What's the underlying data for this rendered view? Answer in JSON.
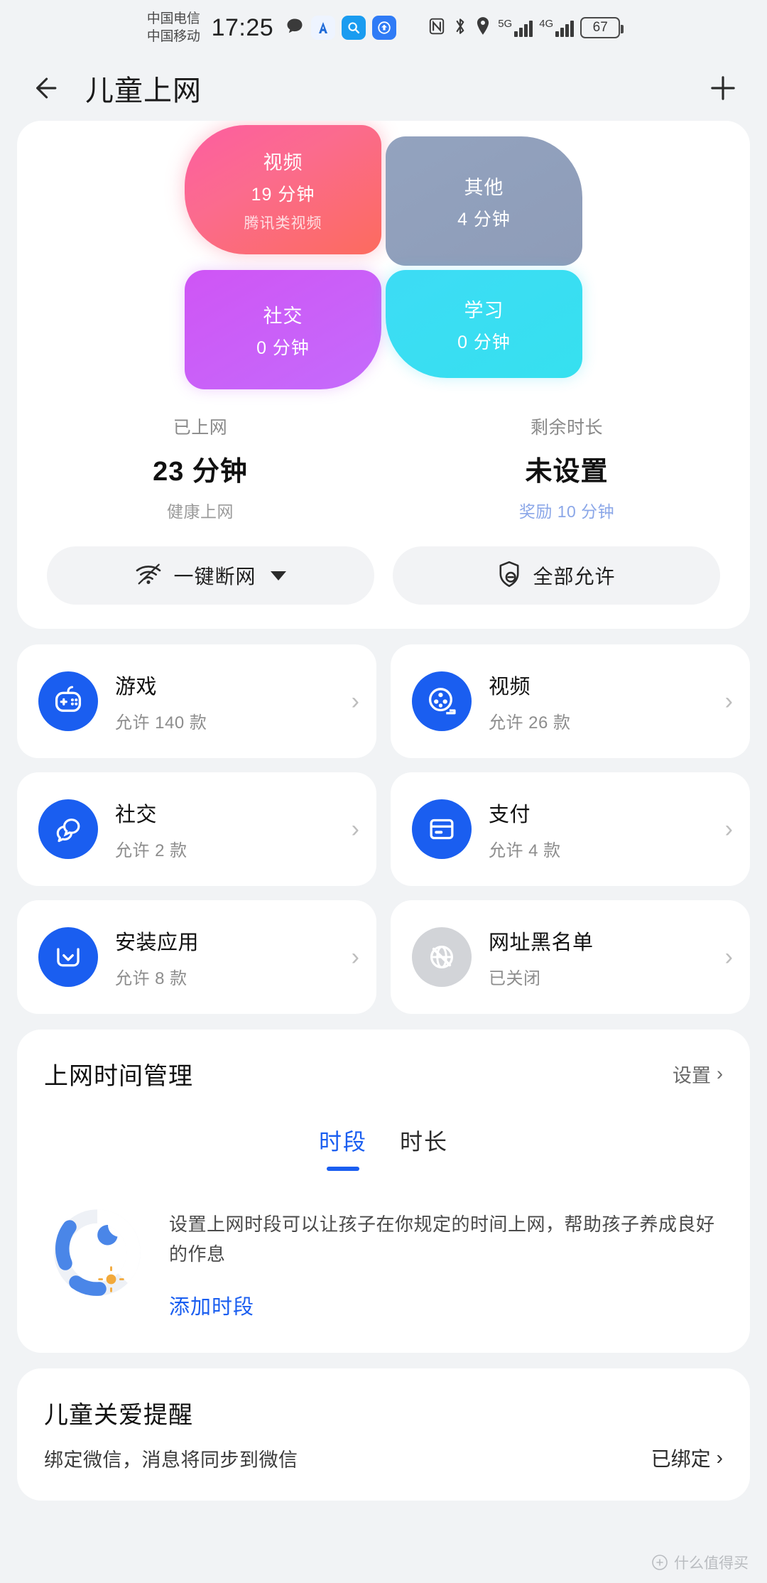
{
  "status_bar": {
    "carrier_top": "中国电信",
    "carrier_bottom": "中国移动",
    "time": "17:25",
    "icons": [
      "message-icon",
      "a-app-icon",
      "search-app-icon",
      "cloud-app-icon",
      "nfc-icon",
      "bluetooth-icon",
      "location-icon"
    ],
    "network_1": "5G",
    "network_2": "4G",
    "battery": "67"
  },
  "app_bar": {
    "back_icon": "arrow-left-icon",
    "title": "儿童上网",
    "add_icon": "plus-icon"
  },
  "usage_tiles": [
    {
      "name": "视频",
      "value": "19 分钟",
      "sub": "腾讯类视频",
      "color": "#fb6480"
    },
    {
      "name": "其他",
      "value": "4 分钟",
      "sub": "",
      "color": "#90a0bb"
    },
    {
      "name": "社交",
      "value": "0 分钟",
      "sub": "",
      "color": "#c85ef8"
    },
    {
      "name": "学习",
      "value": "0 分钟",
      "sub": "",
      "color": "#3adef2"
    }
  ],
  "stats": [
    {
      "label": "已上网",
      "value": "23 分钟",
      "note": "健康上网",
      "note_is_link": false
    },
    {
      "label": "剩余时长",
      "value": "未设置",
      "note": "奖励 10 分钟",
      "note_is_link": true
    }
  ],
  "actions": [
    {
      "label": "一键断网",
      "icon": "wifi-off-icon",
      "has_caret": true
    },
    {
      "label": "全部允许",
      "icon": "shield-block-icon",
      "has_caret": false
    }
  ],
  "categories": [
    {
      "name": "游戏",
      "sub": "允许 140 款",
      "icon": "game-controller-icon",
      "disabled": false
    },
    {
      "name": "视频",
      "sub": "允许 26 款",
      "icon": "film-reel-icon",
      "disabled": false
    },
    {
      "name": "社交",
      "sub": "允许 2 款",
      "icon": "chat-bubbles-icon",
      "disabled": false
    },
    {
      "name": "支付",
      "sub": "允许 4 款",
      "icon": "credit-card-icon",
      "disabled": false
    },
    {
      "name": "安装应用",
      "sub": "允许 8 款",
      "icon": "download-box-icon",
      "disabled": false
    },
    {
      "name": "网址黑名单",
      "sub": "已关闭",
      "icon": "globe-blocked-icon",
      "disabled": true
    }
  ],
  "time_management": {
    "title": "上网时间管理",
    "settings_label": "设置",
    "tabs": [
      {
        "label": "时段",
        "active": true
      },
      {
        "label": "时长",
        "active": false
      }
    ],
    "description": "设置上网时段可以让孩子在你规定的时间上网，帮助孩子养成良好的作息",
    "link": "添加时段",
    "illustration": "clock-moon-sun-icon"
  },
  "care_reminder": {
    "title": "儿童关爱提醒",
    "subtitle": "绑定微信，消息将同步到微信",
    "status": "已绑定"
  },
  "watermark": "什么值得买",
  "colors": {
    "accent": "#1a5ef0",
    "link": "#1a5ef0",
    "page_bg": "#f1f3f5",
    "card_bg": "#ffffff"
  }
}
